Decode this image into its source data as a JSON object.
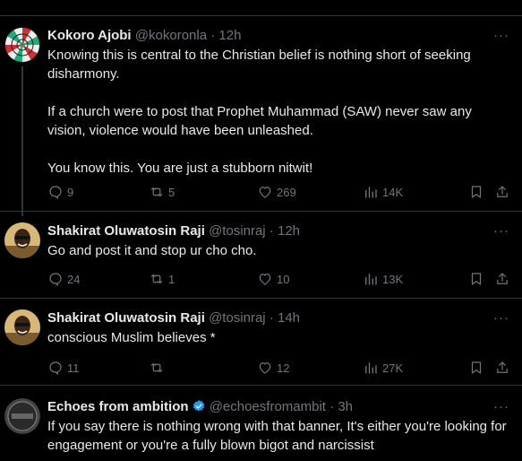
{
  "tweets": [
    {
      "name": "Kokoro Ajobi",
      "handle": "@kokoronla",
      "time": "12h",
      "more": "···",
      "paragraphs": [
        "Knowing this is central to the Christian belief is nothing short of seeking disharmony.",
        "If a church were to post that Prophet Muhammad (SAW) never saw any vision, violence would have been unleashed.",
        "You know this. You are just a stubborn nitwit!"
      ],
      "replies": "9",
      "reposts": "5",
      "likes": "269",
      "views": "14K"
    },
    {
      "name": "Shakirat Oluwatosin Raji",
      "handle": "@tosinraj",
      "time": "12h",
      "more": "···",
      "paragraphs": [
        "Go and post it and stop ur cho cho."
      ],
      "replies": "24",
      "reposts": "1",
      "likes": "10",
      "views": "13K"
    },
    {
      "name": "Shakirat Oluwatosin Raji",
      "handle": "@tosinraj",
      "time": "14h",
      "more": "···",
      "paragraphs": [
        "conscious Muslim believes *"
      ],
      "replies": "11",
      "reposts": "",
      "likes": "12",
      "views": "27K"
    },
    {
      "name": "Echoes from ambition",
      "handle": "@echoesfromambit",
      "time": "3h",
      "more": "···",
      "verified": true,
      "avatar_text": "ECHOES FROM AMBITION",
      "paragraphs": [
        "If you say there is nothing wrong with that banner, It's either you're looking for engagement or you're a fully blown bigot and narcissist"
      ]
    }
  ],
  "separator": " · ",
  "colors": {
    "bg": "#000000",
    "text": "#e7e9ea",
    "muted": "#71767b",
    "border": "#2f3336",
    "verified": "#1d9bf0"
  }
}
